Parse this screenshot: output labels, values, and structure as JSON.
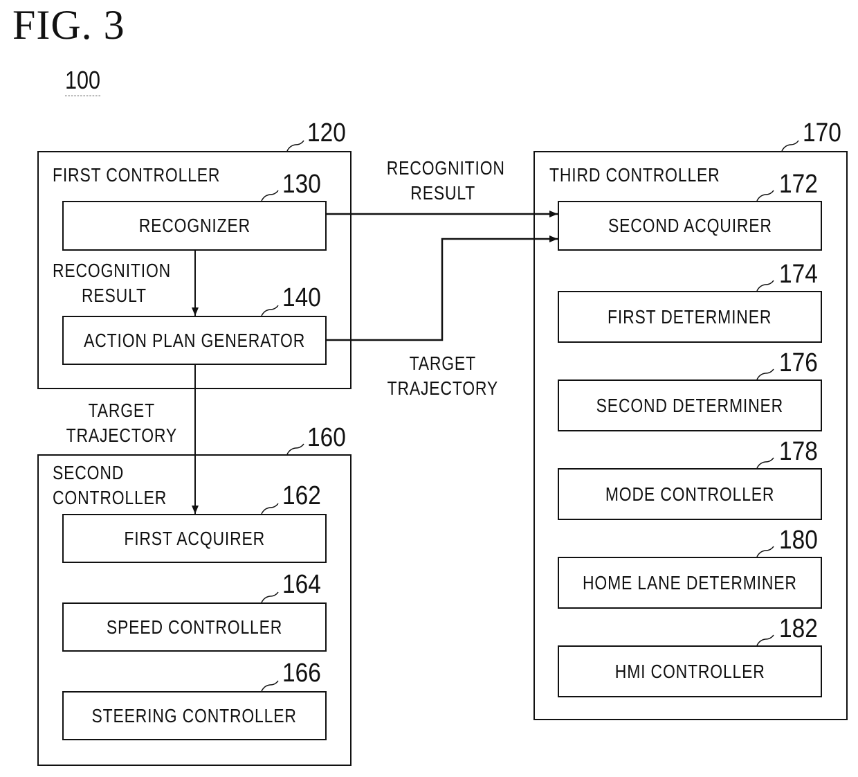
{
  "figure": {
    "title": "FIG. 3",
    "system_ref": "100"
  },
  "first_controller": {
    "title": "FIRST CONTROLLER",
    "ref": "120",
    "blocks": [
      {
        "label": "RECOGNIZER",
        "ref": "130"
      },
      {
        "label": "ACTION PLAN GENERATOR",
        "ref": "140"
      }
    ],
    "internal_arrow_label": [
      "RECOGNITION",
      "RESULT"
    ]
  },
  "second_controller": {
    "title": [
      "SECOND",
      "CONTROLLER"
    ],
    "ref": "160",
    "blocks": [
      {
        "label": "FIRST ACQUIRER",
        "ref": "162"
      },
      {
        "label": "SPEED CONTROLLER",
        "ref": "164"
      },
      {
        "label": "STEERING CONTROLLER",
        "ref": "166"
      }
    ]
  },
  "third_controller": {
    "title": "THIRD CONTROLLER",
    "ref": "170",
    "blocks": [
      {
        "label": "SECOND ACQUIRER",
        "ref": "172"
      },
      {
        "label": "FIRST DETERMINER",
        "ref": "174"
      },
      {
        "label": "SECOND DETERMINER",
        "ref": "176"
      },
      {
        "label": "MODE CONTROLLER",
        "ref": "178"
      },
      {
        "label": "HOME LANE DETERMINER",
        "ref": "180"
      },
      {
        "label": "HMI CONTROLLER",
        "ref": "182"
      }
    ]
  },
  "connections": {
    "recognition_result_label": [
      "RECOGNITION",
      "RESULT"
    ],
    "target_trajectory_right_label": [
      "TARGET",
      "TRAJECTORY"
    ],
    "target_trajectory_down_label": [
      "TARGET",
      "TRAJECTORY"
    ]
  }
}
